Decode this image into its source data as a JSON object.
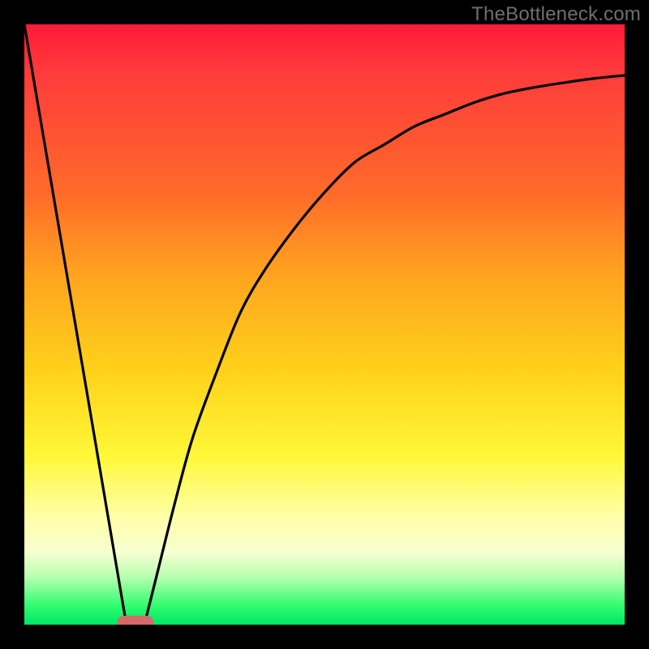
{
  "watermark": {
    "text": "TheBottleneck.com"
  },
  "chart_data": {
    "type": "line",
    "title": "",
    "xlabel": "",
    "ylabel": "",
    "xlim": [
      0,
      100
    ],
    "ylim": [
      0,
      100
    ],
    "grid": false,
    "legend": false,
    "background_gradient_stops": [
      {
        "pos": 0,
        "color": "#ff1a3a"
      },
      {
        "pos": 28,
        "color": "#ff6a2a"
      },
      {
        "pos": 58,
        "color": "#ffd21a"
      },
      {
        "pos": 82,
        "color": "#ffffa8"
      },
      {
        "pos": 97,
        "color": "#2dfc6e"
      },
      {
        "pos": 100,
        "color": "#00e765"
      }
    ],
    "series": [
      {
        "name": "left-line",
        "stroke": "#000000",
        "x": [
          0,
          17
        ],
        "y": [
          100,
          0
        ]
      },
      {
        "name": "right-curve",
        "stroke": "#000000",
        "x": [
          20,
          22,
          25,
          28,
          32,
          36,
          40,
          45,
          50,
          55,
          60,
          65,
          70,
          75,
          80,
          85,
          90,
          95,
          100
        ],
        "y": [
          0,
          8,
          20,
          31,
          42,
          52,
          59,
          66,
          72,
          77,
          80,
          83,
          85,
          87,
          88.5,
          89.5,
          90.3,
          91,
          91.5
        ]
      }
    ],
    "marker": {
      "shape": "rounded-rect",
      "color": "#d46a6a",
      "cx": 18.5,
      "cy": 0.4,
      "w": 6,
      "h": 2.2
    }
  }
}
